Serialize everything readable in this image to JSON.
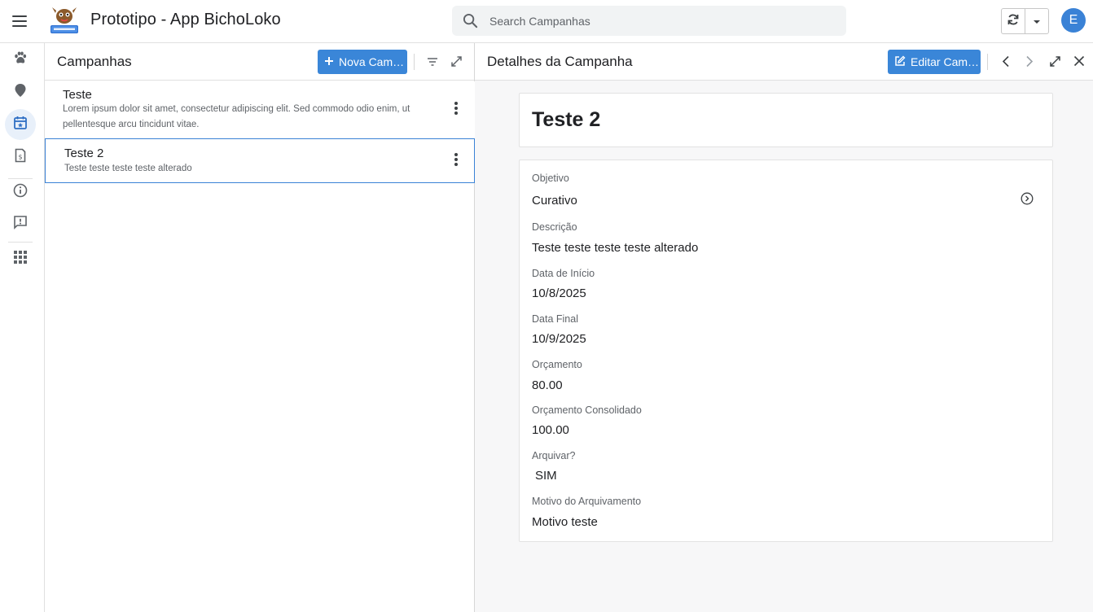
{
  "app": {
    "title": "Prototipo - App BichoLoko",
    "logo_text": "BichoLoko",
    "user_initial": "E"
  },
  "search": {
    "placeholder": "Search Campanhas"
  },
  "rail": {
    "items": [
      {
        "icon": "paw-icon"
      },
      {
        "icon": "map-pin-icon"
      },
      {
        "icon": "calendar-star-icon",
        "active": true
      },
      {
        "icon": "invoice-icon"
      },
      {
        "icon": "info-icon"
      },
      {
        "icon": "feedback-icon"
      },
      {
        "icon": "apps-grid-icon"
      }
    ]
  },
  "list": {
    "title": "Campanhas",
    "new_button": "Nova Cam…",
    "items": [
      {
        "title": "Teste",
        "description": "Lorem ipsum dolor sit amet, consectetur adipiscing elit. Sed commodo odio enim, ut pellentesque arcu tincidunt vitae."
      },
      {
        "title": "Teste 2",
        "description": "Teste teste teste teste alterado",
        "selected": true
      }
    ]
  },
  "detail": {
    "header": "Detalhes da Campanha",
    "edit_button": "Editar Cam…",
    "title": "Teste 2",
    "fields": [
      {
        "label": "Objetivo",
        "value": "Curativo"
      },
      {
        "label": "Descrição",
        "value": "Teste teste teste teste alterado"
      },
      {
        "label": "Data de Início",
        "value": "10/8/2025"
      },
      {
        "label": "Data Final",
        "value": "10/9/2025"
      },
      {
        "label": "Orçamento",
        "value": "80.00"
      },
      {
        "label": "Orçamento Consolidado",
        "value": "100.00"
      },
      {
        "label": "Arquivar?",
        "value": "SIM"
      },
      {
        "label": "Motivo do Arquivamento",
        "value": "Motivo teste"
      }
    ]
  },
  "colors": {
    "accent": "#3a86d8",
    "selected_border": "#3a82d6",
    "rail_active_bg": "#e8f0fa",
    "detail_bg": "#f7f7f8"
  }
}
